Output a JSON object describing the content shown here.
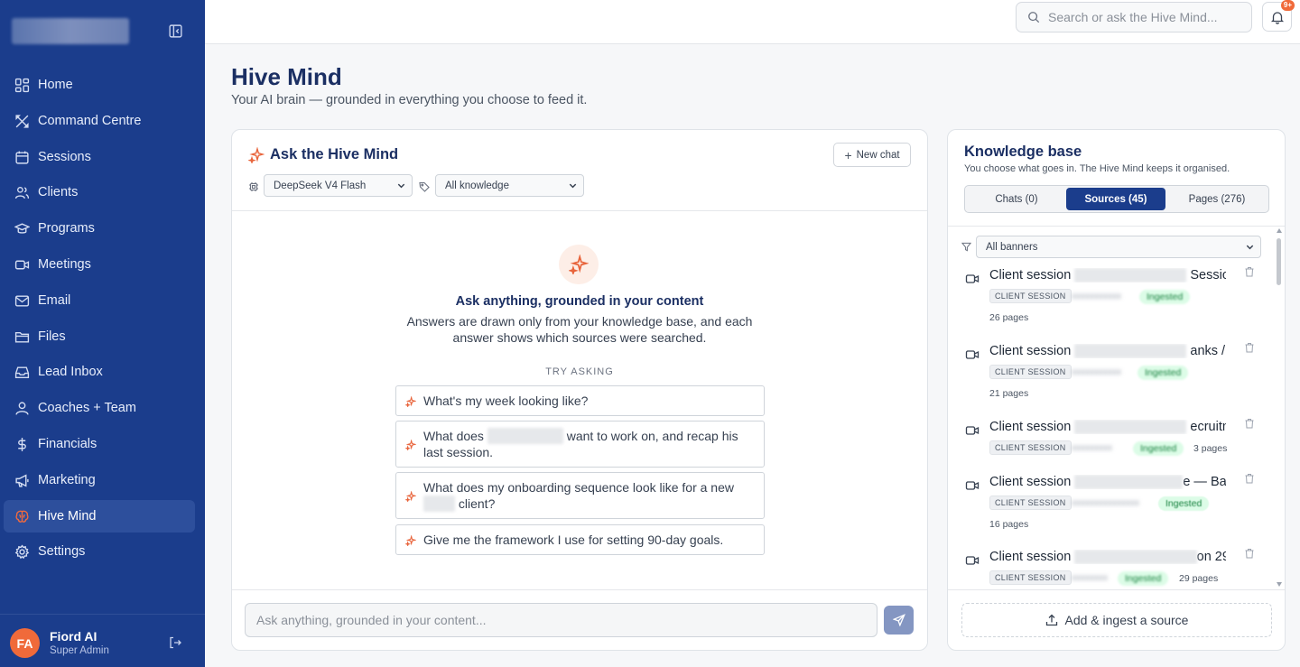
{
  "sidebar": {
    "items": [
      {
        "label": "Home",
        "icon": "home-icon"
      },
      {
        "label": "Command Centre",
        "icon": "command-icon"
      },
      {
        "label": "Sessions",
        "icon": "calendar-icon"
      },
      {
        "label": "Clients",
        "icon": "users-icon"
      },
      {
        "label": "Programs",
        "icon": "graduation-icon"
      },
      {
        "label": "Meetings",
        "icon": "video-icon"
      },
      {
        "label": "Email",
        "icon": "mail-icon"
      },
      {
        "label": "Files",
        "icon": "folder-icon"
      },
      {
        "label": "Lead Inbox",
        "icon": "inbox-icon"
      },
      {
        "label": "Coaches + Team",
        "icon": "team-icon"
      },
      {
        "label": "Financials",
        "icon": "dollar-icon"
      },
      {
        "label": "Marketing",
        "icon": "megaphone-icon"
      },
      {
        "label": "Hive Mind",
        "icon": "brain-icon",
        "active": true
      },
      {
        "label": "Settings",
        "icon": "gear-icon"
      }
    ],
    "user": {
      "initials": "FA",
      "name": "Fiord AI",
      "role": "Super Admin"
    }
  },
  "topbar": {
    "search_placeholder": "Search or ask the Hive Mind...",
    "notification_count": "9+"
  },
  "page": {
    "title": "Hive Mind",
    "subtitle": "Your AI brain — grounded in everything you choose to feed it."
  },
  "chat": {
    "title": "Ask the Hive Mind",
    "new_chat_label": "New chat",
    "model_select": "DeepSeek V4 Flash",
    "knowledge_select": "All knowledge",
    "empty_title": "Ask anything, grounded in your content",
    "empty_desc": "Answers are drawn only from your knowledge base, and each answer shows which sources were searched.",
    "try_label": "TRY ASKING",
    "suggestions": [
      {
        "pre": "What's my week looking like?"
      },
      {
        "pre": "What does ",
        "post": " want to work on, and recap his last session."
      },
      {
        "pre": "What does my onboarding sequence look like for a new ",
        "post": " client?"
      },
      {
        "pre": "Give me the framework I use for setting 90-day goals."
      }
    ],
    "input_placeholder": "Ask anything, grounded in your content..."
  },
  "kb": {
    "title": "Knowledge base",
    "subtitle": "You choose what goes in. The Hive Mind keeps it organised.",
    "tabs": [
      {
        "label": "Chats (0)"
      },
      {
        "label": "Sources (45)",
        "active": true
      },
      {
        "label": "Pages (276)"
      }
    ],
    "filter": "All banners",
    "sources": [
      {
        "name_start": "Client session",
        "name_end": "Session ...",
        "tag": "CLIENT SESSION",
        "status": "Ingested",
        "pages": "26 pages"
      },
      {
        "name_start": "Client session",
        "name_end": "anks / C...",
        "tag": "CLIENT SESSION",
        "status": "Ingested",
        "pages": "21 pages"
      },
      {
        "name_start": "Client session",
        "name_end": "ecruitm...",
        "tag": "CLIENT SESSION",
        "status": "Ingested",
        "pages": "3 pages"
      },
      {
        "name_start": "Client session",
        "name_end": "e — Ba...",
        "tag": "CLIENT SESSION",
        "status": "Ingested",
        "pages": "16 pages"
      },
      {
        "name_start": "Client session",
        "name_end": "on 29",
        "tag": "CLIENT SESSION",
        "status": "Ingested",
        "pages": "29 pages"
      }
    ],
    "add_label": "Add & ingest a source"
  }
}
